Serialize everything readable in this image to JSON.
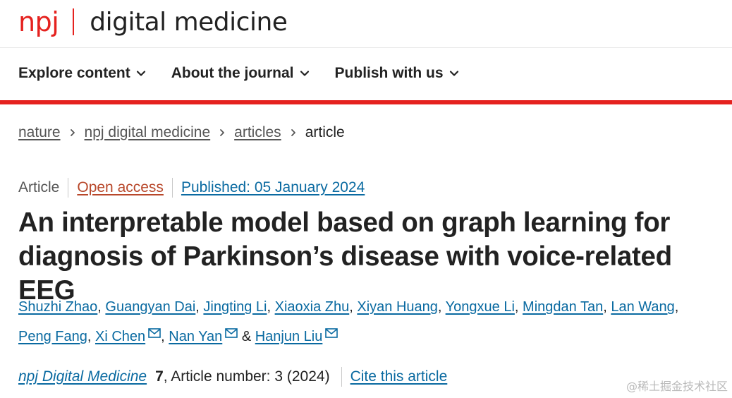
{
  "brand": {
    "npj": "npj",
    "journal_title": "digital medicine",
    "accent_color": "#e5221f"
  },
  "nav": {
    "items": [
      {
        "label": "Explore content",
        "icon": "chevron-down-icon"
      },
      {
        "label": "About the journal",
        "icon": "chevron-down-icon"
      },
      {
        "label": "Publish with us",
        "icon": "chevron-down-icon"
      }
    ]
  },
  "breadcrumb": {
    "items": [
      "nature",
      "npj digital medicine",
      "articles"
    ],
    "current": "article",
    "separator_icon": "chevron-right-icon"
  },
  "article": {
    "type": "Article",
    "access": "Open access",
    "published": "Published: 05 January 2024",
    "title": "An interpretable model based on graph learning for diagnosis of Parkinson’s disease with voice-related EEG",
    "authors": [
      {
        "name": "Shuzhi Zhao",
        "sep": ", ",
        "email": false
      },
      {
        "name": "Guangyan Dai",
        "sep": ", ",
        "email": false
      },
      {
        "name": "Jingting Li",
        "sep": ", ",
        "email": false
      },
      {
        "name": "Xiaoxia Zhu",
        "sep": ", ",
        "email": false
      },
      {
        "name": "Xiyan Huang",
        "sep": ", ",
        "email": false
      },
      {
        "name": "Yongxue Li",
        "sep": ", ",
        "email": false
      },
      {
        "name": "Mingdan Tan",
        "sep": ", ",
        "email": false
      },
      {
        "name": "Lan Wang",
        "sep": ",",
        "email": false
      },
      {
        "name": "Peng Fang",
        "sep": ", ",
        "email": false
      },
      {
        "name": "Xi Chen",
        "sep": ", ",
        "email": true
      },
      {
        "name": "Nan Yan",
        "sep": " & ",
        "email": true
      },
      {
        "name": "Hanjun Liu",
        "sep": "",
        "email": true
      }
    ],
    "citation": {
      "journal": "npj Digital Medicine",
      "volume": "7",
      "rest": ", Article number: 3 (2024)",
      "cite_link": "Cite this article"
    }
  },
  "watermark": "@稀土掘金技术社区",
  "colors": {
    "link": "#0a6aa1",
    "open_access": "#b8472a",
    "text": "#222222",
    "muted": "#555555"
  }
}
